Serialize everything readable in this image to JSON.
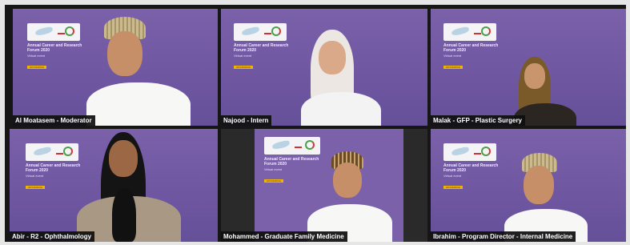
{
  "slide": {
    "title": "Annual Career and Research Forum 2020",
    "subtitle": "Virtual event",
    "badge": "UPCOMING"
  },
  "participants": [
    {
      "name": "Al Moatasem - Moderator"
    },
    {
      "name": "Najood - Intern"
    },
    {
      "name": "Malak - GFP - Plastic Surgery"
    },
    {
      "name": "Abir - R2 - Ophthalmology"
    },
    {
      "name": "Mohammed - Graduate Family Medicine"
    },
    {
      "name": "Ibrahim - Program Director - Internal Medicine"
    }
  ],
  "colors": {
    "background": "#7060a5",
    "label_bg": "#0f0f0f",
    "badge": "#f0b400"
  }
}
